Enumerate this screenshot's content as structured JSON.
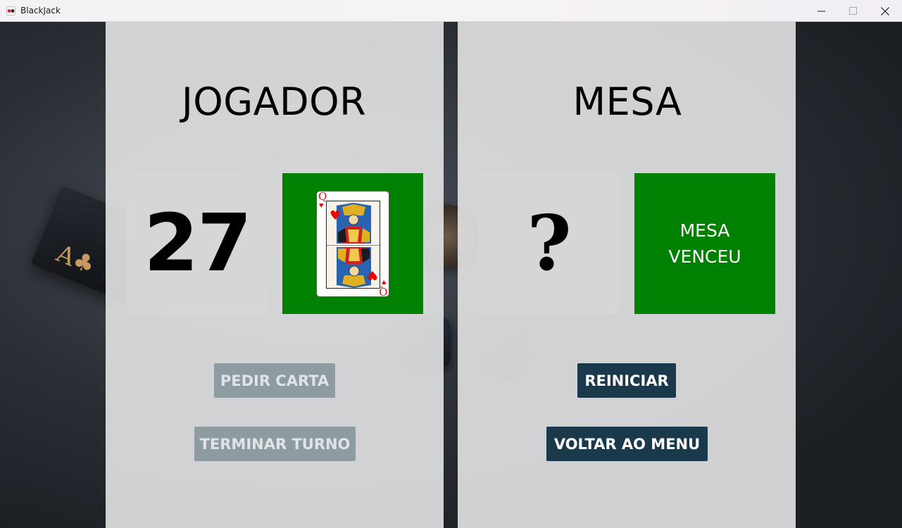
{
  "window": {
    "title": "BlackJack",
    "minimize_label": "—",
    "maximize_label": "☐",
    "close_label": "✕"
  },
  "background": {
    "ace_glyph": "A♣"
  },
  "player": {
    "title": "JOGADOR",
    "score": "27",
    "card": {
      "rank": "Q",
      "suit": "♥",
      "suit_color": "#e00000"
    },
    "buttons": {
      "hit": {
        "label": "PEDIR CARTA",
        "enabled": false
      },
      "stand": {
        "label": "TERMINAR TURNO",
        "enabled": false
      }
    }
  },
  "dealer": {
    "title": "MESA",
    "score": "?",
    "result": "MESA VENCEU",
    "buttons": {
      "restart": {
        "label": "REINICIAR",
        "enabled": true
      },
      "menu": {
        "label": "VOLTAR AO MENU",
        "enabled": true
      }
    }
  },
  "colors": {
    "green": "#018101",
    "button_active": "#1a3a4c",
    "button_disabled": "#8e9ba1",
    "panel": "#e4e4e6"
  }
}
